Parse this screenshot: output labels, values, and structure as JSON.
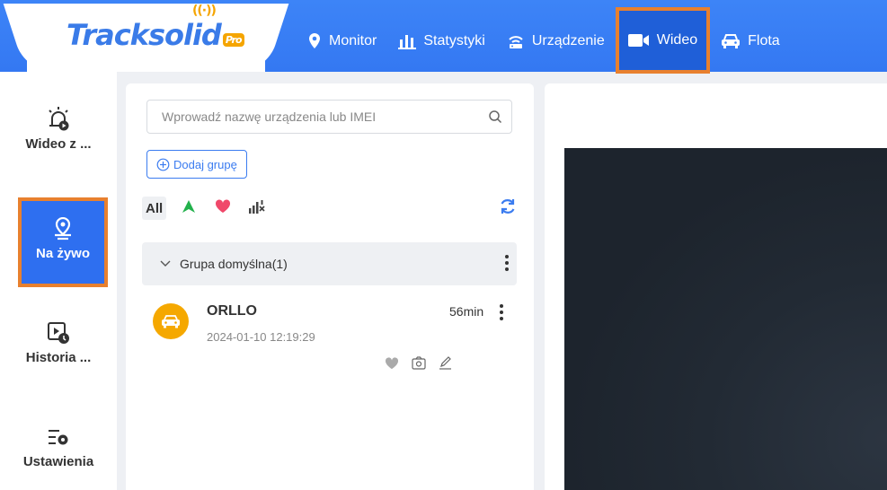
{
  "brand": {
    "name": "Tracksolid",
    "badge": "Pro"
  },
  "nav": {
    "items": [
      {
        "label": "Monitor",
        "icon": "location-pin-icon"
      },
      {
        "label": "Statystyki",
        "icon": "bar-chart-icon"
      },
      {
        "label": "Urządzenie",
        "icon": "router-icon"
      },
      {
        "label": "Wideo",
        "icon": "video-camera-icon",
        "active": true
      },
      {
        "label": "Flota",
        "icon": "car-icon"
      }
    ]
  },
  "sidebar": {
    "items": [
      {
        "label": "Wideo z ...",
        "icon": "alarm-video-icon"
      },
      {
        "label": "Na żywo",
        "icon": "live-location-icon",
        "active": true
      },
      {
        "label": "Historia ...",
        "icon": "video-history-icon"
      },
      {
        "label": "Ustawienia",
        "icon": "settings-list-icon"
      }
    ]
  },
  "devices_panel": {
    "search_placeholder": "Wprowadź nazwę urządzenia lub IMEI",
    "add_group_label": "Dodaj grupę",
    "filters": {
      "all_label": "All"
    },
    "group": {
      "name": "Grupa domyślna(1)"
    },
    "devices": [
      {
        "name": "ORLLO",
        "datetime": "2024-01-10 12:19:29",
        "duration": "56min"
      }
    ]
  },
  "colors": {
    "primary": "#3b82f6",
    "highlight_border": "#e8802e",
    "device_avatar": "#f5a800",
    "video_bg": "#1f262f"
  }
}
